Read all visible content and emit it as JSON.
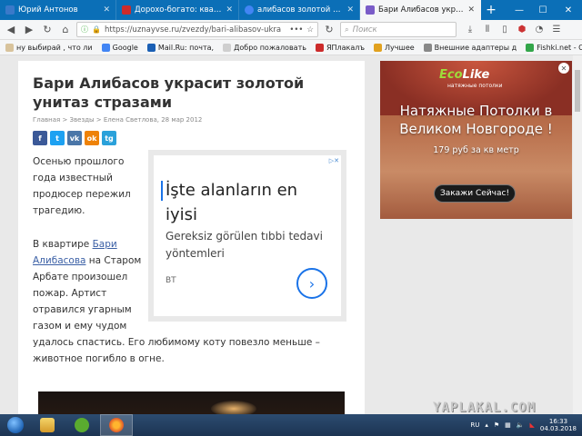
{
  "tabs": [
    {
      "label": "Юрий Антонов",
      "color": "#3a79c9",
      "active": false
    },
    {
      "label": "Дороxo-богато: квартира и",
      "color": "#cc2b2b",
      "active": false
    },
    {
      "label": "алибасов золотой унитаз",
      "color": "#4285f4",
      "active": false
    },
    {
      "label": "Бари Алибасов украсит зо",
      "color": "#7a5cc8",
      "active": true
    }
  ],
  "nav": {
    "url": "https://uznayvse.ru/zvezdy/bari-alibasov-ukra",
    "search_placeholder": "Поиск"
  },
  "bookmarks": [
    {
      "label": "ну выбирай , что ли",
      "color": "#d8c39c"
    },
    {
      "label": "Google",
      "color": "#4285f4"
    },
    {
      "label": "Mail.Ru: почта,",
      "color": "#1a5fb4"
    },
    {
      "label": "Добро пожаловать",
      "color": "#cfcfcf"
    },
    {
      "label": "ЯПлакалъ",
      "color": "#cc2b2b"
    },
    {
      "label": "Лучшее",
      "color": "#e1a11f"
    },
    {
      "label": "Внешние адаптеры д",
      "color": "#888888"
    },
    {
      "label": "Fishki.net - Сайт хоро",
      "color": "#33a64a"
    }
  ],
  "article": {
    "title": "Бари Алибасов украсит золотой унитаз стразами",
    "breadcrumb": "Главная > Звезды > Елена Светлова, 28 мар 2012",
    "p1": "Осенью прошлого года известный продюсер пережил трагедию.",
    "p2_pre": "В квартире ",
    "p2_link": "Бари Алибасова",
    "p2_post": " на Старом Арбате произошел пожар. Артист отравился угарным газом и ему чудом",
    "p3": "удалось спастись. Его любимому коту повезло меньше – животное погибло в огне."
  },
  "share_buttons": [
    {
      "label": "f",
      "color": "#3b5998"
    },
    {
      "label": "t",
      "color": "#1da1f2"
    },
    {
      "label": "vk",
      "color": "#4a76a8"
    },
    {
      "label": "ok",
      "color": "#ee8208"
    },
    {
      "label": "tg",
      "color": "#2aa1da"
    }
  ],
  "inline_ad": {
    "headline": "İşte alanların en iyisi",
    "body": "Gereksiz görülen tıbbi tedavi yöntemleri",
    "source": "BT"
  },
  "side_ad": {
    "logo_a": "Eco",
    "logo_b": "Like",
    "tagline": "натяжные потолки",
    "headline": "Натяжные Потолки в Великом Новгороде !",
    "price": "179 руб за кв метр",
    "cta": "Закажи Сейчас!"
  },
  "watermark": "YAPLAKAL.COM",
  "taskbar": {
    "lang": "RU",
    "time": "16:33",
    "date": "04.03.2018"
  }
}
